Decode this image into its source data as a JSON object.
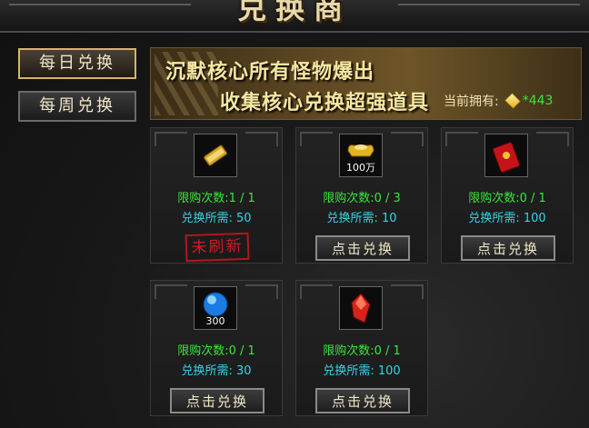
{
  "window": {
    "title": "兑换商"
  },
  "sidebar": {
    "tabs": [
      {
        "label": "每日兑换",
        "active": true
      },
      {
        "label": "每周兑换",
        "active": false
      }
    ]
  },
  "banner": {
    "line1": "沉默核心所有怪物爆出",
    "line2": "收集核心兑换超强道具",
    "owned_label": "当前拥有:",
    "owned_icon": "core-crystal-icon",
    "owned_count": "*443"
  },
  "items": [
    {
      "icon": "golden-scroll-icon",
      "icon_label": "",
      "limit": "限购次数:1 / 1",
      "cost": "兑换所需: 50",
      "action": "未刷新",
      "state": "stamp"
    },
    {
      "icon": "gold-ingot-icon",
      "icon_label": "100万",
      "limit": "限购次数:0 / 3",
      "cost": "兑换所需: 10",
      "action": "点击兑换",
      "state": "button"
    },
    {
      "icon": "red-envelope-icon",
      "icon_label": "",
      "limit": "限购次数:0 / 1",
      "cost": "兑换所需: 100",
      "action": "点击兑换",
      "state": "button"
    },
    {
      "icon": "blue-orb-icon",
      "icon_label": "300",
      "limit": "限购次数:0 / 1",
      "cost": "兑换所需: 30",
      "action": "点击兑换",
      "state": "button"
    },
    {
      "icon": "red-crystal-icon",
      "icon_label": "",
      "limit": "限购次数:0 / 1",
      "cost": "兑换所需: 100",
      "action": "点击兑换",
      "state": "button"
    }
  ],
  "colors": {
    "limit": "#39e639",
    "cost": "#37d4e6",
    "stamp": "#cc1d22",
    "banner_text": "#f6e7a0"
  }
}
